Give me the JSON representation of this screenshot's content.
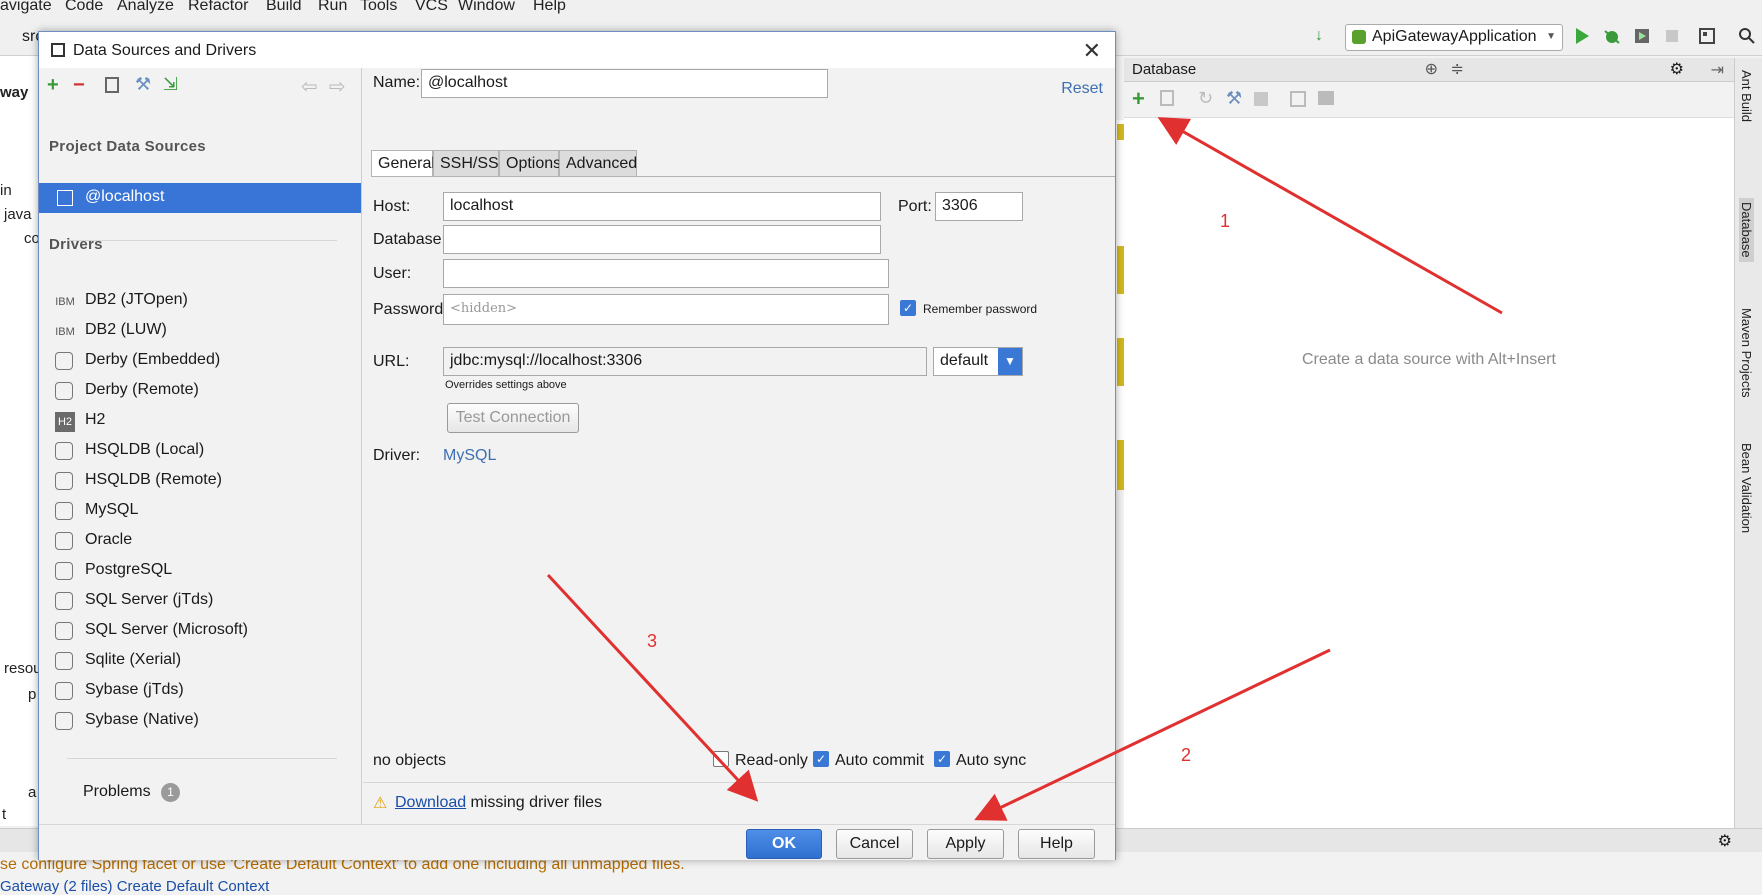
{
  "menu": [
    "avigate",
    "Code",
    "Analyze",
    "Refactor",
    "Build",
    "Run",
    "Tools",
    "VCS",
    "Window",
    "Help"
  ],
  "ide": {
    "breadcrumb_src": "src",
    "run_config": "ApiGatewayApplication",
    "left_fragments": [
      "way",
      "in",
      "java",
      "co",
      "resou",
      "p",
      "a",
      "t"
    ],
    "database_panel_title": "Database",
    "database_hint": "Create a data source with Alt+Insert",
    "right_tool_windows": [
      "Ant Build",
      "Database",
      "Maven Projects",
      "Bean Validation"
    ],
    "status_line1": "se configure Spring facet or use 'Create Default Context' to add one including all unmapped files.",
    "status_line2": "Gateway (2 files)   Create Default Context"
  },
  "dialog": {
    "title": "Data Sources and Drivers",
    "project_data_sources_label": "Project Data Sources",
    "selected_source": "@localhost",
    "drivers_label": "Drivers",
    "drivers": [
      {
        "name": "DB2 (JTOpen)",
        "icon": "IBM"
      },
      {
        "name": "DB2 (LUW)",
        "icon": "IBM"
      },
      {
        "name": "Derby (Embedded)",
        "icon": "derby-icon"
      },
      {
        "name": "Derby (Remote)",
        "icon": "derby-icon"
      },
      {
        "name": "H2",
        "icon": "H2"
      },
      {
        "name": "HSQLDB (Local)",
        "icon": "hsqldb-icon"
      },
      {
        "name": "HSQLDB (Remote)",
        "icon": "hsqldb-icon"
      },
      {
        "name": "MySQL",
        "icon": "mysql-icon"
      },
      {
        "name": "Oracle",
        "icon": "oracle-icon"
      },
      {
        "name": "PostgreSQL",
        "icon": "postgresql-icon"
      },
      {
        "name": "SQL Server (jTds)",
        "icon": "sqlserver-icon"
      },
      {
        "name": "SQL Server (Microsoft)",
        "icon": "sqlserver-icon"
      },
      {
        "name": "Sqlite (Xerial)",
        "icon": "sqlite-icon"
      },
      {
        "name": "Sybase (jTds)",
        "icon": "sybase-icon"
      },
      {
        "name": "Sybase (Native)",
        "icon": "sybase-icon"
      }
    ],
    "problems_label": "Problems",
    "problems_count": "1",
    "name_label": "Name:",
    "name_value": "@localhost",
    "reset_label": "Reset",
    "tabs": [
      "General",
      "SSH/SSL",
      "Options",
      "Advanced"
    ],
    "host_label": "Host:",
    "host_value": "localhost",
    "port_label": "Port:",
    "port_value": "3306",
    "database_label": "Database:",
    "database_value": "",
    "user_label": "User:",
    "user_value": "",
    "password_label": "Password:",
    "password_placeholder": "<hidden>",
    "remember_password_label": "Remember password",
    "url_label": "URL:",
    "url_value": "jdbc:mysql://localhost:3306",
    "url_mode": "default",
    "url_hint": "Overrides settings above",
    "test_connection_label": "Test Connection",
    "driver_label": "Driver:",
    "driver_value": "MySQL",
    "objects_status": "no objects",
    "readonly_label": "Read-only",
    "autocommit_label": "Auto commit",
    "autosync_label": "Auto sync",
    "download_link": "Download",
    "download_rest": " missing driver files",
    "ok_label": "OK",
    "cancel_label": "Cancel",
    "apply_label": "Apply",
    "help_label": "Help"
  },
  "annotations": [
    "1",
    "2",
    "3"
  ],
  "colors": {
    "accent": "#3875d7",
    "arrow": "#e03030",
    "link": "#3e6fb0"
  }
}
